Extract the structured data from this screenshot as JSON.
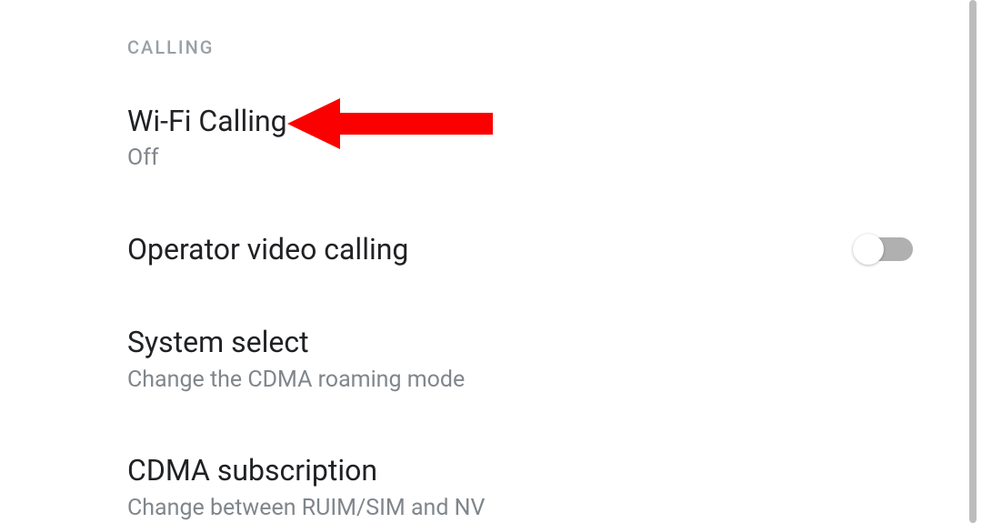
{
  "section_header": "CALLING",
  "settings": {
    "wifi_calling": {
      "title": "Wi-Fi Calling",
      "subtitle": "Off"
    },
    "operator_video": {
      "title": "Operator video calling",
      "toggle_on": false
    },
    "system_select": {
      "title": "System select",
      "subtitle": "Change the CDMA roaming mode"
    },
    "cdma_subscription": {
      "title": "CDMA subscription",
      "subtitle": "Change between RUIM/SIM and NV"
    }
  },
  "annotation": {
    "arrow_color": "#fb0000",
    "points_to": "wifi_calling"
  }
}
